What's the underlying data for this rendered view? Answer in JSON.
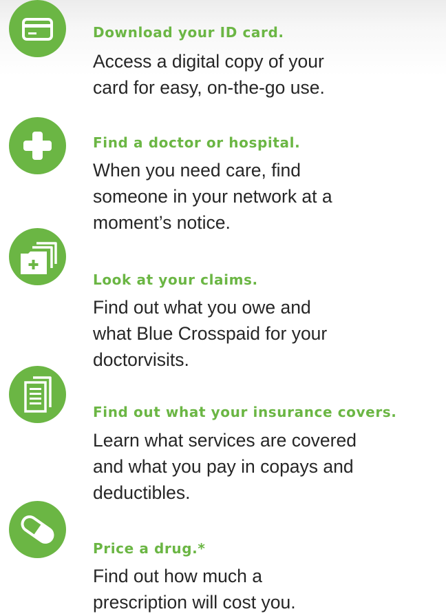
{
  "colors": {
    "accent_green": "#6bb644",
    "body_text": "#262626",
    "background": "#ffffff"
  },
  "features": [
    {
      "icon": "id-card-icon",
      "title": "Download your ID card.",
      "lines": [
        "Access a digital copy of your",
        "card for easy, on-the-go use."
      ]
    },
    {
      "icon": "plus-icon",
      "title": "Find a doctor or hospital.",
      "lines": [
        "When you need care, find",
        "someone in your network at a",
        "moment’s notice."
      ]
    },
    {
      "icon": "claims-folder-icon",
      "title": "Look at your claims.",
      "lines": [
        "Find out what you owe and",
        "what Blue Crosspaid for your",
        "doctorvisits."
      ]
    },
    {
      "icon": "document-icon",
      "title": "Find out what your insurance covers.",
      "lines": [
        "Learn what services are covered",
        "and what you pay in copays and",
        "deductibles."
      ]
    },
    {
      "icon": "pill-icon",
      "title": "Price a drug.*",
      "lines": [
        "Find out how much a",
        "prescription will cost you."
      ]
    }
  ]
}
